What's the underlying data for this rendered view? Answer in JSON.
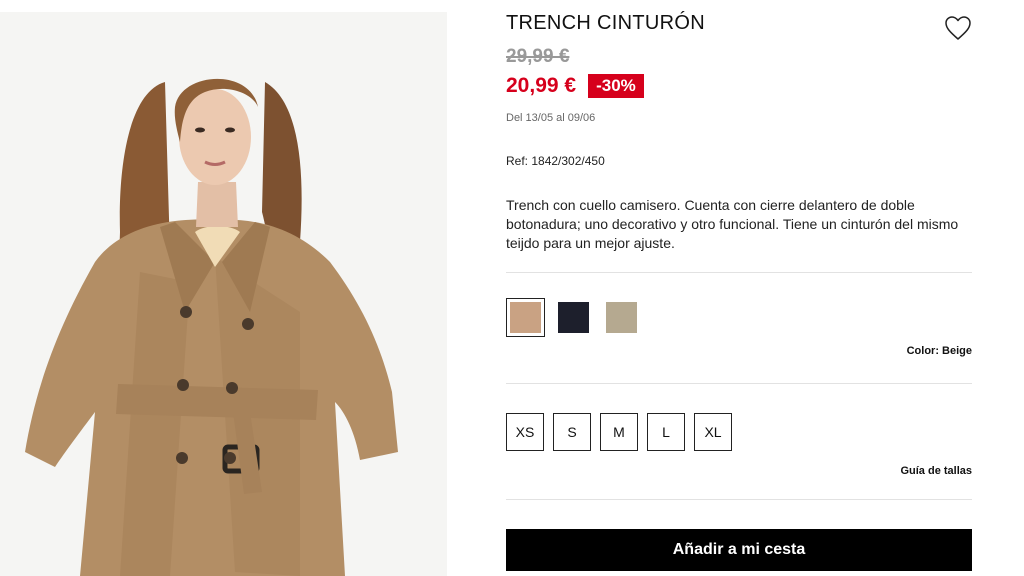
{
  "product": {
    "title": "TRENCH CINTURÓN",
    "old_price": "29,99 €",
    "price": "20,99 €",
    "discount": "-30%",
    "dates": "Del 13/05 al 09/06",
    "reference": "Ref: 1842/302/450",
    "description": "Trench con cuello camisero. Cuenta con cierre delantero de doble botonadura; uno decorativo y otro funcional. Tiene un cinturón del mismo teijdo para un mejor ajuste."
  },
  "colors": {
    "swatches": [
      {
        "name": "beige",
        "hex": "#c9a283",
        "selected": true
      },
      {
        "name": "navy",
        "hex": "#1d1f2c",
        "selected": false
      },
      {
        "name": "stone",
        "hex": "#b5a990",
        "selected": false
      }
    ],
    "label": "Color: Beige"
  },
  "sizes": {
    "options": [
      "XS",
      "S",
      "M",
      "L",
      "XL"
    ],
    "guide_label": "Guía de tallas"
  },
  "actions": {
    "add_to_cart": "Añadir a mi cesta",
    "favorite_icon": "heart-icon"
  },
  "theme": {
    "accent": "#d6001c",
    "button_bg": "#000000"
  }
}
